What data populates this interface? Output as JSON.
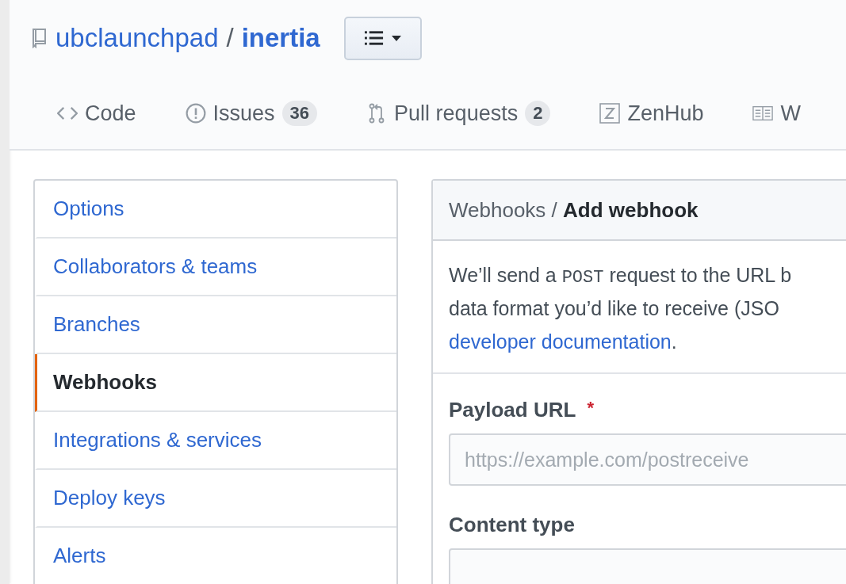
{
  "repo": {
    "owner": "ubclaunchpad",
    "separator": "/",
    "name": "inertia"
  },
  "tabs": [
    {
      "label": "Code",
      "kind": "code",
      "selected": false
    },
    {
      "label": "Issues",
      "kind": "issue",
      "count": "36",
      "selected": false
    },
    {
      "label": "Pull requests",
      "kind": "pull",
      "count": "2",
      "selected": false
    },
    {
      "label": "ZenHub",
      "kind": "zenhub",
      "selected": false
    },
    {
      "label": "W",
      "kind": "book",
      "selected": false
    }
  ],
  "sidebar": {
    "items": [
      {
        "label": "Options",
        "selected": false
      },
      {
        "label": "Collaborators & teams",
        "selected": false
      },
      {
        "label": "Branches",
        "selected": false
      },
      {
        "label": "Webhooks",
        "selected": true
      },
      {
        "label": "Integrations & services",
        "selected": false
      },
      {
        "label": "Deploy keys",
        "selected": false
      },
      {
        "label": "Alerts",
        "selected": false
      }
    ]
  },
  "panel": {
    "breadcrumb": {
      "parent": "Webhooks",
      "separator": "/",
      "current": "Add webhook"
    },
    "description": [
      [
        {
          "kind": "text",
          "text": "We’ll send a "
        },
        {
          "kind": "code",
          "text": "POST"
        },
        {
          "kind": "text",
          "text": " request to the URL b"
        }
      ],
      [
        {
          "kind": "text",
          "text": "data format you’d like to receive (JSO"
        }
      ],
      [
        {
          "kind": "link",
          "text": "developer documentation"
        },
        {
          "kind": "text",
          "text": "."
        }
      ]
    ],
    "fields": [
      {
        "label": "Payload URL",
        "required_mark": "*",
        "placeholder": "https://example.com/postreceive"
      },
      {
        "label": "Content type"
      }
    ]
  }
}
